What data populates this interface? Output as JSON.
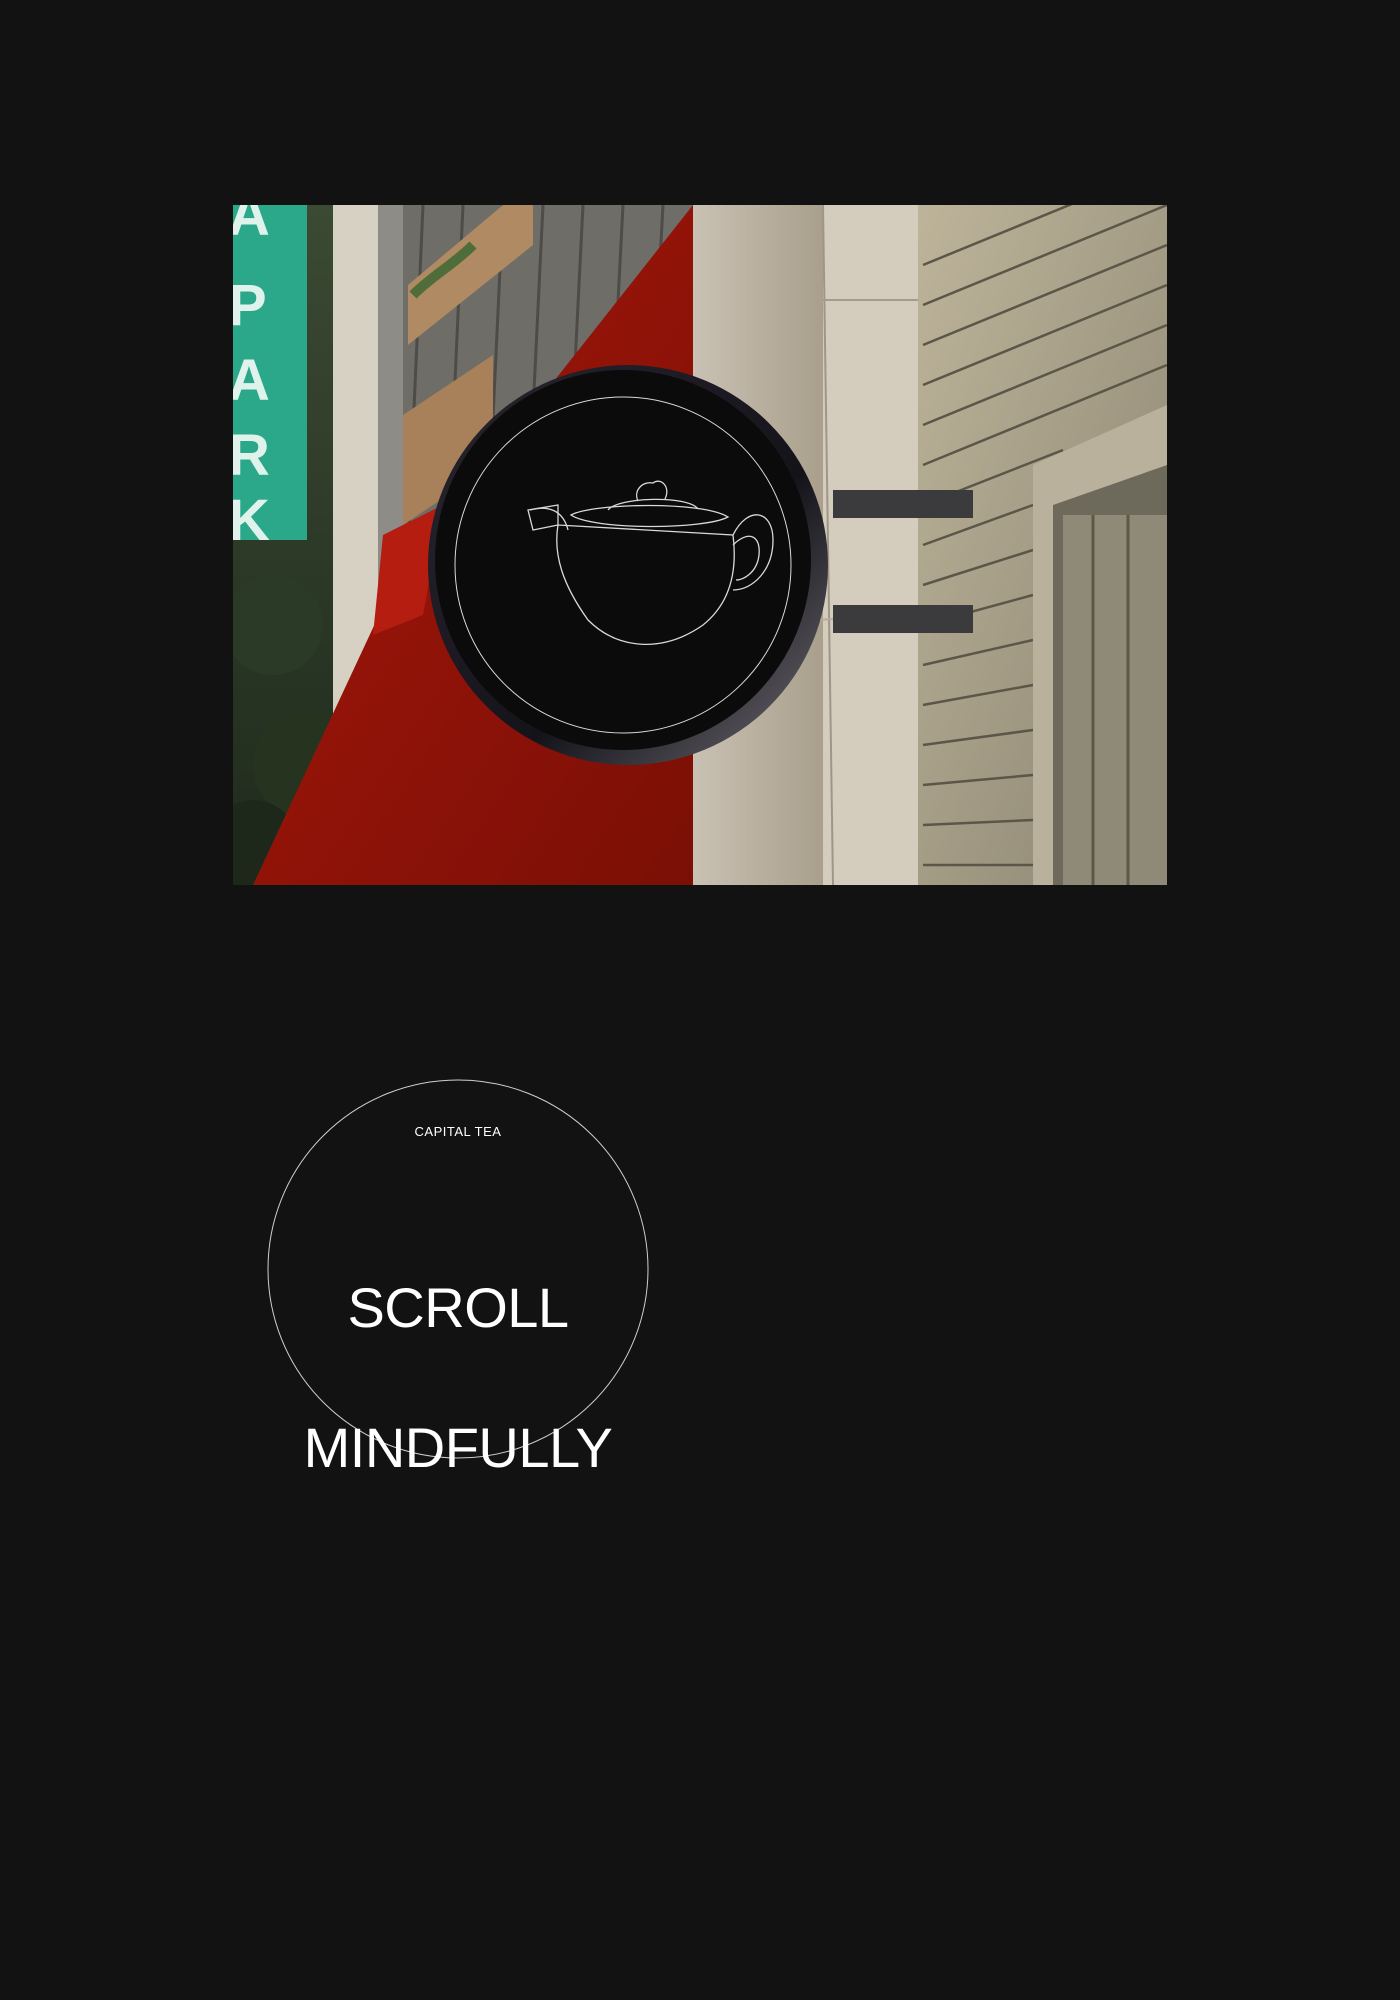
{
  "photo": {
    "scene": "storefront-sign-photo",
    "street_sign_text": "PARK",
    "sign_icon": "teapot-icon"
  },
  "badge": {
    "brand": "CAPITAL TEA",
    "line1": "SCROLL",
    "line2": "MINDFULLY"
  },
  "colors": {
    "background": "#121212",
    "awning_red": "#8e1208",
    "street_sign_green": "#2aa889",
    "sign_disc": "#0b0b0b",
    "outline": "#d9d9d9"
  }
}
